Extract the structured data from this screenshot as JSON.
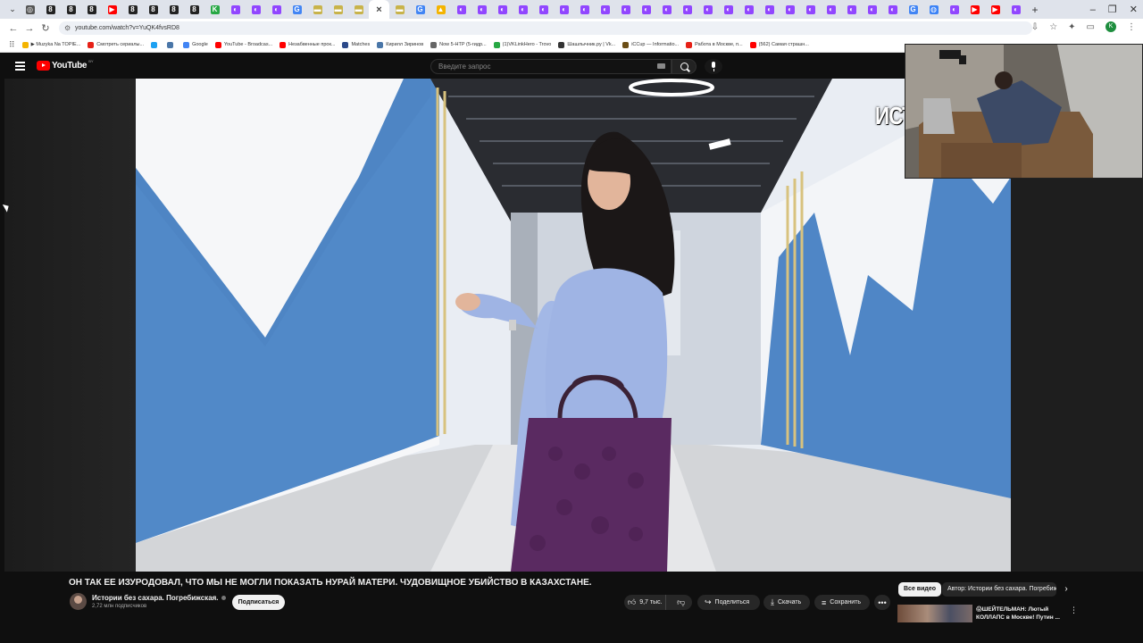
{
  "browser": {
    "url": "youtube.com/watch?v=YuQK4fvsRD8",
    "tabs": [
      {
        "icon": "chrome-icon",
        "color": "#555555",
        "glyph": "◎"
      },
      {
        "icon": "8-icon",
        "color": "#222222",
        "glyph": "8"
      },
      {
        "icon": "8-icon",
        "color": "#222222",
        "glyph": "8"
      },
      {
        "icon": "8-icon",
        "color": "#222222",
        "glyph": "8"
      },
      {
        "icon": "youtube-icon",
        "color": "#ff0000",
        "glyph": "▶"
      },
      {
        "icon": "8-icon",
        "color": "#222222",
        "glyph": "8"
      },
      {
        "icon": "8-icon",
        "color": "#222222",
        "glyph": "8"
      },
      {
        "icon": "8-icon",
        "color": "#222222",
        "glyph": "8"
      },
      {
        "icon": "8-icon",
        "color": "#222222",
        "glyph": "8"
      },
      {
        "icon": "k-icon",
        "color": "#27a844",
        "glyph": "K"
      },
      {
        "icon": "twitch-icon",
        "color": "#9146ff",
        "glyph": "◐"
      },
      {
        "icon": "twitch-icon",
        "color": "#9146ff",
        "glyph": "◐"
      },
      {
        "icon": "twitch-icon",
        "color": "#9146ff",
        "glyph": "◐"
      },
      {
        "icon": "google-icon",
        "color": "#4285f4",
        "glyph": "G"
      },
      {
        "icon": "folder-icon",
        "color": "#c8b34a",
        "glyph": "▬"
      },
      {
        "icon": "folder-icon",
        "color": "#c8b34a",
        "glyph": "▬"
      },
      {
        "icon": "folder-icon",
        "color": "#c8b34a",
        "glyph": "▬"
      },
      {
        "icon": "close-icon",
        "color": "#444444",
        "glyph": "×"
      },
      {
        "icon": "folder-icon",
        "color": "#c8b34a",
        "glyph": "▬"
      },
      {
        "icon": "google-icon",
        "color": "#4285f4",
        "glyph": "G"
      },
      {
        "icon": "drive-icon",
        "color": "#f4b400",
        "glyph": "▲"
      },
      {
        "icon": "twitch-icon",
        "color": "#9146ff",
        "glyph": "◐"
      },
      {
        "icon": "twitch-icon",
        "color": "#9146ff",
        "glyph": "◐"
      },
      {
        "icon": "twitch-icon",
        "color": "#9146ff",
        "glyph": "◐"
      },
      {
        "icon": "twitch-icon",
        "color": "#9146ff",
        "glyph": "◐"
      },
      {
        "icon": "twitch-icon",
        "color": "#9146ff",
        "glyph": "◐"
      },
      {
        "icon": "twitch-icon",
        "color": "#9146ff",
        "glyph": "◐"
      },
      {
        "icon": "twitch-icon",
        "color": "#9146ff",
        "glyph": "◐"
      },
      {
        "icon": "twitch-icon",
        "color": "#9146ff",
        "glyph": "◐"
      },
      {
        "icon": "twitch-icon",
        "color": "#9146ff",
        "glyph": "◐"
      },
      {
        "icon": "twitch-icon",
        "color": "#9146ff",
        "glyph": "◐"
      },
      {
        "icon": "twitch-icon",
        "color": "#9146ff",
        "glyph": "◐"
      },
      {
        "icon": "twitch-icon",
        "color": "#9146ff",
        "glyph": "◐"
      },
      {
        "icon": "twitch-icon",
        "color": "#9146ff",
        "glyph": "◐"
      },
      {
        "icon": "twitch-icon",
        "color": "#9146ff",
        "glyph": "◐"
      },
      {
        "icon": "twitch-icon",
        "color": "#9146ff",
        "glyph": "◐"
      },
      {
        "icon": "twitch-icon",
        "color": "#9146ff",
        "glyph": "◐"
      },
      {
        "icon": "twitch-icon",
        "color": "#9146ff",
        "glyph": "◐"
      },
      {
        "icon": "twitch-icon",
        "color": "#9146ff",
        "glyph": "◐"
      },
      {
        "icon": "twitch-icon",
        "color": "#9146ff",
        "glyph": "◐"
      },
      {
        "icon": "twitch-icon",
        "color": "#9146ff",
        "glyph": "◐"
      },
      {
        "icon": "twitch-icon",
        "color": "#9146ff",
        "glyph": "◐"
      },
      {
        "icon": "twitch-icon",
        "color": "#9146ff",
        "glyph": "◐"
      },
      {
        "icon": "google-icon",
        "color": "#4285f4",
        "glyph": "G"
      },
      {
        "icon": "globe-icon",
        "color": "#3b82f6",
        "glyph": "◍"
      },
      {
        "icon": "twitch-icon",
        "color": "#9146ff",
        "glyph": "◐"
      },
      {
        "icon": "youtube-icon",
        "color": "#ff0000",
        "glyph": "▶"
      },
      {
        "icon": "youtube-icon",
        "color": "#ff0000",
        "glyph": "▶"
      },
      {
        "icon": "twitch-icon",
        "color": "#9146ff",
        "glyph": "◐"
      }
    ],
    "bookmarks": [
      {
        "label": "▶ Muzyka Na TOPIE...",
        "color": "#f4b400"
      },
      {
        "label": "Смотреть сериалы...",
        "color": "#e62117"
      },
      {
        "label": "",
        "color": "#1da1f2"
      },
      {
        "label": "",
        "color": "#4a76a8"
      },
      {
        "label": "Google",
        "color": "#4285f4"
      },
      {
        "label": "YouTube - Broadcas...",
        "color": "#ff0000"
      },
      {
        "label": "Незабвенные прок...",
        "color": "#ff0000"
      },
      {
        "label": "Matches",
        "color": "#2c4a8a"
      },
      {
        "label": "Кирилл Зиринов",
        "color": "#4a76a8"
      },
      {
        "label": "Now 5-HTP (5-гидр...",
        "color": "#666666"
      },
      {
        "label": "(1)VKLinkHero - Trovo",
        "color": "#27a844"
      },
      {
        "label": "Шашлычник.ру | Vk...",
        "color": "#333333"
      },
      {
        "label": "iCCup — Informatio...",
        "color": "#6b4e16"
      },
      {
        "label": "Работа в Москве, п...",
        "color": "#e62117"
      },
      {
        "label": "(562) Самая страшн...",
        "color": "#ff0000"
      }
    ]
  },
  "youtube": {
    "logo_text": "YouTube",
    "region": "BY",
    "search_placeholder": "Введите запрос"
  },
  "video": {
    "overlay_text": "ИСТОРИИ БЕЗ",
    "title": "ОН ТАК ЕЕ ИЗУРОДОВАЛ, ЧТО МЫ НЕ МОГЛИ ПОКАЗАТЬ НУРАЙ МАТЕРИ. ЧУДОВИЩНОЕ УБИЙСТВО В КАЗАХСТАНЕ.",
    "channel_name": "Истории без сахара. Погребижская.",
    "subscribers": "2,72 млн подписчиков",
    "subscribe_label": "Подписаться",
    "likes": "9,7 тыс.",
    "share_label": "Поделиться",
    "download_label": "Скачать",
    "save_label": "Сохранить"
  },
  "sidebar": {
    "chips": {
      "all": "Все видео",
      "author": "Автор: Истории без сахара. Погребижская."
    },
    "rec_title": "😱ШЕЙТЕЛЬМАН: Лютый КОЛЛАПС в Москве! Путин ..."
  },
  "colors": {
    "yt_red": "#ff0000",
    "bg": "#0f0f0f",
    "wall_blue": "#4f86c6"
  }
}
